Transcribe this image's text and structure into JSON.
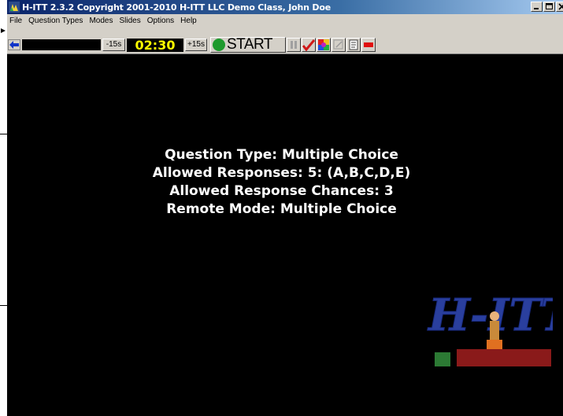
{
  "window": {
    "title": "H-ITT 2.3.2 Copyright 2001-2010 H-ITT LLC Demo Class, John Doe"
  },
  "menu": {
    "items": [
      {
        "label": "File"
      },
      {
        "label": "Question Types"
      },
      {
        "label": "Modes"
      },
      {
        "label": "Slides"
      },
      {
        "label": "Options"
      },
      {
        "label": "Help"
      }
    ]
  },
  "toolbar": {
    "minus_label": "-15s",
    "timer": "02:30",
    "plus_label": "+15s",
    "start_label": "START"
  },
  "info": {
    "question_type": "Question Type: Multiple Choice",
    "allowed_responses": "Allowed Responses: 5: (A,B,C,D,E)",
    "response_chances": "Allowed Response Chances: 3",
    "remote_mode": "Remote Mode: Multiple Choice"
  },
  "logo": {
    "text": "H-ITT"
  },
  "colors": {
    "title_bar": "#0a246a",
    "chrome": "#d4d0c8",
    "timer_text": "#ffff00",
    "start_green": "#1e9a2e",
    "logo_blue": "#2a3f9e",
    "background": "#000000"
  }
}
